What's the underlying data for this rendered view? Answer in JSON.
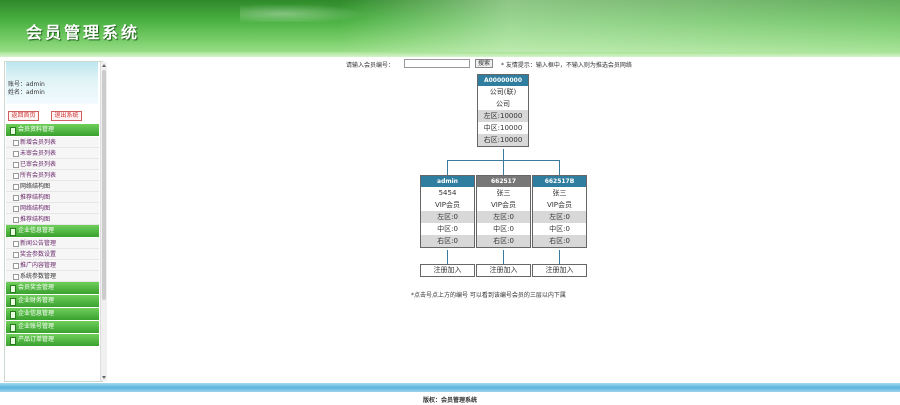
{
  "header": {
    "title": "会员管理系统"
  },
  "sidebar": {
    "user_line1": "账号：admin",
    "user_line2": "姓名：admin",
    "btn_home": "返回首页",
    "btn_logout": "退出系统",
    "groups": [
      {
        "label": "会员资料管理",
        "items": [
          "新增会员列表",
          "未审会员列表",
          "已审会员列表",
          "所有会员列表",
          "网络结构图",
          "推荐结构图",
          "网络结构图",
          "推荐结构图"
        ]
      },
      {
        "label": "企业信息管理",
        "items": [
          "新闻公告管理",
          "奖金参数设置",
          "推广内容管理",
          "系统参数管理"
        ]
      },
      {
        "label": "会员奖金管理",
        "items": []
      },
      {
        "label": "企业财务管理",
        "items": []
      },
      {
        "label": "企业信息管理",
        "items": []
      },
      {
        "label": "企业账号管理",
        "items": []
      },
      {
        "label": "产品订单管理",
        "items": []
      }
    ]
  },
  "search": {
    "label": "请输入会员编号：",
    "button": "搜索",
    "tip": "* 友情提示：输入框中，不输入则为推选会员网络"
  },
  "tree": {
    "root": {
      "id": "A00000000",
      "name": "公司(联)",
      "level": "公司",
      "left": "左区:10000",
      "mid": "中区:10000",
      "right": "右区:10000"
    },
    "children": [
      {
        "id": "admin",
        "name": "5454",
        "level": "VIP会员",
        "left": "左区:0",
        "mid": "中区:0",
        "right": "右区:0"
      },
      {
        "id": "662517",
        "name": "张三",
        "level": "VIP会员",
        "left": "左区:0",
        "mid": "中区:0",
        "right": "右区:0"
      },
      {
        "id": "662517B",
        "name": "张三",
        "level": "VIP会员",
        "left": "左区:0",
        "mid": "中区:0",
        "right": "右区:0"
      }
    ],
    "register_label": "注册加入",
    "note": "*点击号点上方的编号 可以看到该编号会员的三层以内下属"
  },
  "footer": {
    "text": "版权：会员管理系统"
  }
}
